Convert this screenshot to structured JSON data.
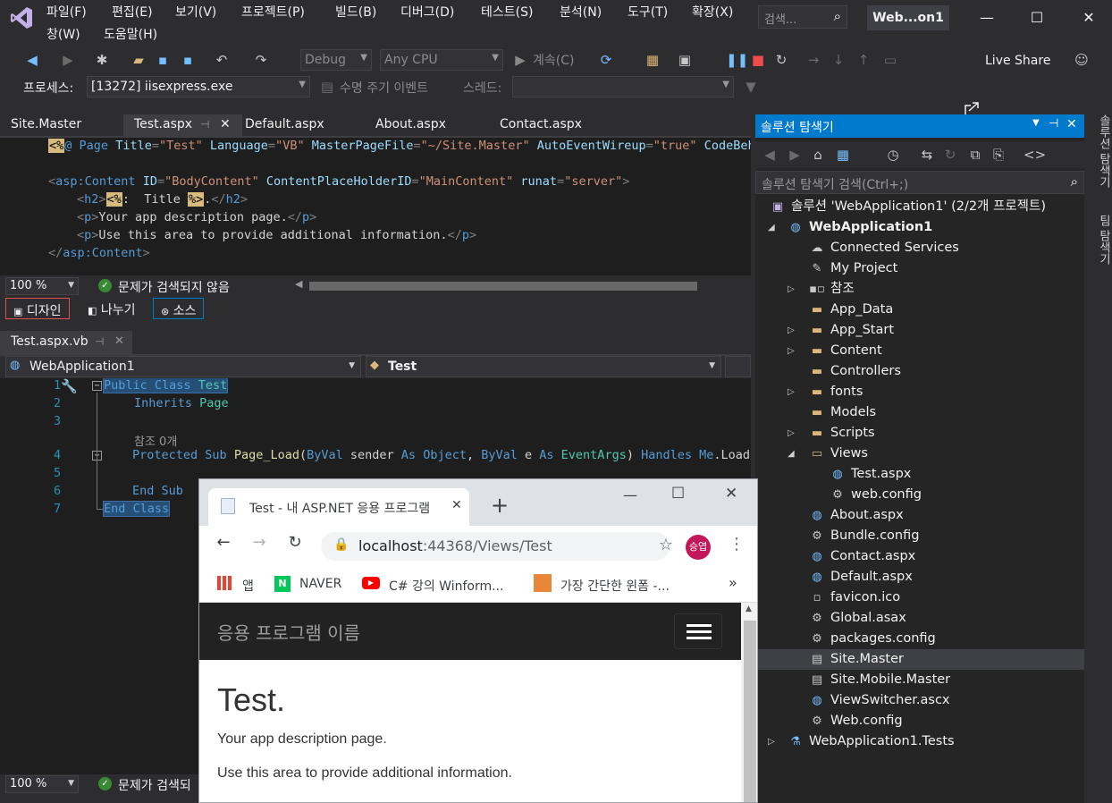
{
  "menu": {
    "row1": [
      "파일(F)",
      "편집(E)",
      "보기(V)",
      "프로젝트(P)",
      "빌드(B)",
      "디버그(D)",
      "테스트(S)",
      "분석(N)",
      "도구(T)",
      "확장(X)"
    ],
    "row2": [
      "창(W)",
      "도움말(H)"
    ],
    "search_placeholder": "검색...",
    "window_name": "Web...on1"
  },
  "toolbar": {
    "config": "Debug",
    "platform": "Any CPU",
    "continue": "계속(C)",
    "live_share": "Live Share",
    "process_label": "프로세스:",
    "process_value": "[13272] iisexpress.exe",
    "lifecycle": "수명 주기 이벤트",
    "thread": "스레드:"
  },
  "doc_tabs": [
    "Site.Master",
    "Test.aspx",
    "Default.aspx",
    "About.aspx",
    "Contact.aspx"
  ],
  "aspx_code": {
    "line1_directive": "@ Page",
    "line1_title_attr": "Title",
    "line1_title_val": "\"Test\"",
    "line1_lang_attr": "Language",
    "line1_lang_val": "\"VB\"",
    "line1_master_attr": "MasterPageFile",
    "line1_master_val": "\"~/Site.Master\"",
    "line1_auto_attr": "AutoEventWireup",
    "line1_auto_val": "\"true\"",
    "line1_cb": "CodeBehi",
    "content_tag": "asp:Content",
    "id_attr": "ID",
    "id_val": "\"BodyContent\"",
    "cph_attr": "ContentPlaceHolderID",
    "cph_val": "\"MainContent\"",
    "runat_attr": "runat",
    "runat_val": "\"server\"",
    "h2_text": " Title ",
    "p1_text": "Your app description page.",
    "p2_text": "Use this area to provide additional information."
  },
  "status": {
    "zoom": "100 %",
    "no_issues": "문제가 검색되지 않음",
    "no_issues_short": "문제가 검색되"
  },
  "view_buttons": {
    "design": "디자인",
    "split": "나누기",
    "source": "소스"
  },
  "vb_tab": "Test.aspx.vb",
  "vb_nav": {
    "project": "WebApplication1",
    "class": "Test"
  },
  "vb_code": {
    "line_numbers": [
      "1",
      "2",
      "3",
      "",
      "4",
      "5",
      "6",
      "7"
    ],
    "public_class": "Public Class",
    "class_name": "Test",
    "inherits": "Inherits",
    "page": "Page",
    "ref_count": "참조 0개",
    "protected_sub": "Protected Sub",
    "page_load": "Page_Load",
    "byval1": "ByVal",
    "sender": " sender ",
    "as1": "As",
    "object": "Object",
    "byval2": "ByVal",
    "e": " e ",
    "as2": "As",
    "eventargs": "EventArgs",
    "handles": "Handles",
    "me": "Me",
    "load": ".Load",
    "end_sub": "End Sub",
    "end_class": "End Class"
  },
  "solution_explorer": {
    "title": "솔루션 탐색기",
    "search_placeholder": "솔루션 탐색기 검색(Ctrl+;)",
    "solution": "솔루션 'WebApplication1' (2/2개 프로젝트)",
    "project": "WebApplication1",
    "items": [
      "Connected Services",
      "My Project",
      "참조",
      "App_Data",
      "App_Start",
      "Content",
      "Controllers",
      "fonts",
      "Models",
      "Scripts",
      "Views",
      "Test.aspx",
      "web.config",
      "About.aspx",
      "Bundle.config",
      "Contact.aspx",
      "Default.aspx",
      "favicon.ico",
      "Global.asax",
      "packages.config",
      "Site.Master",
      "Site.Mobile.Master",
      "ViewSwitcher.ascx",
      "Web.config",
      "WebApplication1.Tests"
    ],
    "side_tabs": [
      "솔루션 탐색기",
      "팀 탐색기"
    ]
  },
  "browser": {
    "tab_title": "Test - 내 ASP.NET 응용 프로그램",
    "url_host": "localhost",
    "url_path": ":44368/Views/Test",
    "profile": "승엽",
    "bookmarks": [
      "앱",
      "NAVER",
      "C# 강의 Winform...",
      "가장 간단한 윈폼 -..."
    ],
    "more": "»",
    "site_brand": "응용 프로그램 이름",
    "heading": "Test.",
    "p1": "Your app description page.",
    "p2": "Use this area to provide additional information."
  }
}
